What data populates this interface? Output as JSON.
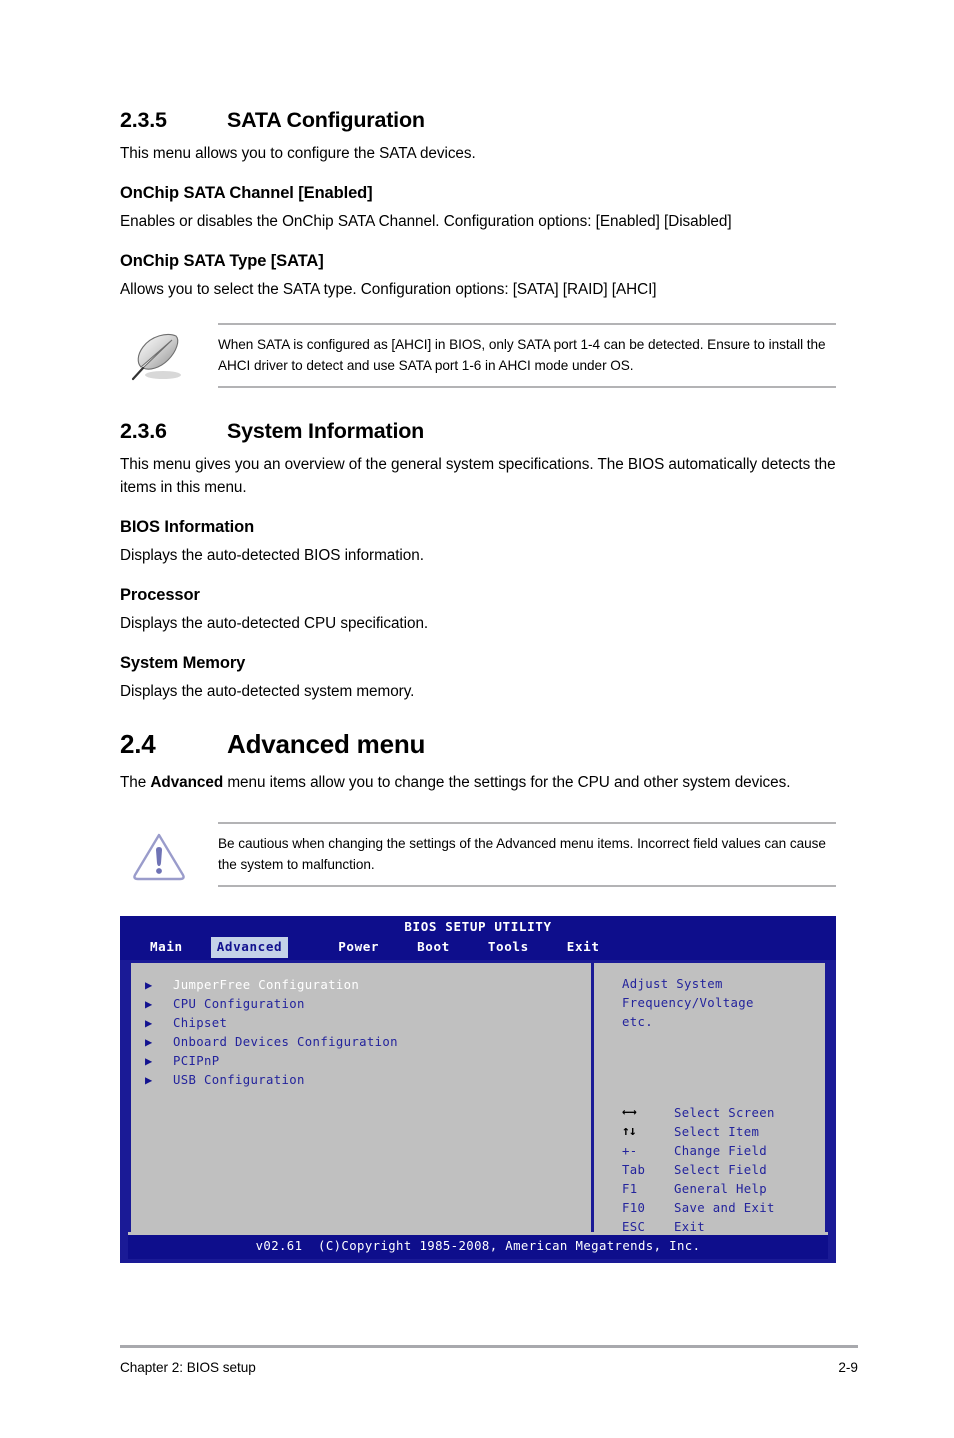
{
  "document": {
    "sections": [
      {
        "number": "2.3.5",
        "title": "SATA Configuration",
        "intro": "This menu allows you to configure the SATA devices.",
        "subsections": [
          {
            "heading": "OnChip SATA Channel [Enabled]",
            "text": "Enables or disables the OnChip SATA Channel. Configuration options: [Enabled] [Disabled]"
          },
          {
            "heading": "OnChip SATA Type [SATA]",
            "text": "Allows you to select the SATA type. Configuration options: [SATA] [RAID] [AHCI]"
          }
        ]
      }
    ],
    "note_box": {
      "icon": "note-quill-pen-icon",
      "text": "When SATA is configured as [AHCI] in BIOS, only SATA port 1-4 can be detected. Ensure to install the AHCI driver to detect and use SATA port 1-6 in AHCI mode under OS."
    },
    "section_236": {
      "number": "2.3.6",
      "title": "System Information",
      "intro": "This menu gives you an overview of the general system specifications. The BIOS automatically detects the items in this menu.",
      "subsections": [
        {
          "heading": "BIOS Information",
          "text": "Displays the auto-detected BIOS information."
        },
        {
          "heading": "Processor",
          "text": "Displays the auto-detected CPU specification."
        },
        {
          "heading": "System Memory",
          "text": "Displays the auto-detected system memory."
        }
      ]
    },
    "section_24": {
      "number": "2.4",
      "title": "Advanced menu",
      "intro_parts": {
        "before": "The ",
        "bold": "Advanced",
        "after": " menu items allow you to change the settings for the CPU and other system devices."
      }
    },
    "caution_box": {
      "icon": "caution-triangle-icon",
      "text": "Be cautious when changing the settings of the Advanced menu items. Incorrect field values can cause the system to malfunction."
    },
    "footer": {
      "left": "Chapter 2: BIOS setup",
      "page": "2-9"
    }
  },
  "bios_screen": {
    "title": "BIOS SETUP UTILITY",
    "tabs": [
      {
        "label": "Main",
        "active": false
      },
      {
        "label": "Advanced",
        "active": true
      },
      {
        "label": "Power",
        "active": false
      },
      {
        "label": "Boot",
        "active": false
      },
      {
        "label": "Tools",
        "active": false
      },
      {
        "label": "Exit",
        "active": false
      }
    ],
    "menu_items": [
      {
        "label": "JumperFree Configuration",
        "selected": true
      },
      {
        "label": "CPU Configuration",
        "selected": false
      },
      {
        "label": "Chipset",
        "selected": false
      },
      {
        "label": "Onboard Devices Configuration",
        "selected": false
      },
      {
        "label": "PCIPnP",
        "selected": false
      },
      {
        "label": "USB Configuration",
        "selected": false
      }
    ],
    "help_lines": [
      "Adjust System",
      "Frequency/Voltage",
      "etc."
    ],
    "legend": [
      {
        "key": "←→",
        "glyph": true,
        "action": "Select Screen"
      },
      {
        "key": "↑↓",
        "glyph": true,
        "action": "Select Item"
      },
      {
        "key": "+-",
        "glyph": false,
        "action": "Change Field"
      },
      {
        "key": "Tab",
        "glyph": false,
        "action": "Select Field"
      },
      {
        "key": "F1",
        "glyph": false,
        "action": "General Help"
      },
      {
        "key": "F10",
        "glyph": false,
        "action": "Save and Exit"
      },
      {
        "key": "ESC",
        "glyph": false,
        "action": "Exit"
      }
    ],
    "copyright": "v02.61  (C)Copyright 1985-2008, American Megatrends, Inc.",
    "colors": {
      "header_bg": "#0e0e8c",
      "border": "#1a1a96",
      "panel_bg": "#c0c0c0",
      "text_blue": "#23239c",
      "tab_active_bg": "#c4d2e8",
      "selected_text": "#ffffff"
    }
  }
}
